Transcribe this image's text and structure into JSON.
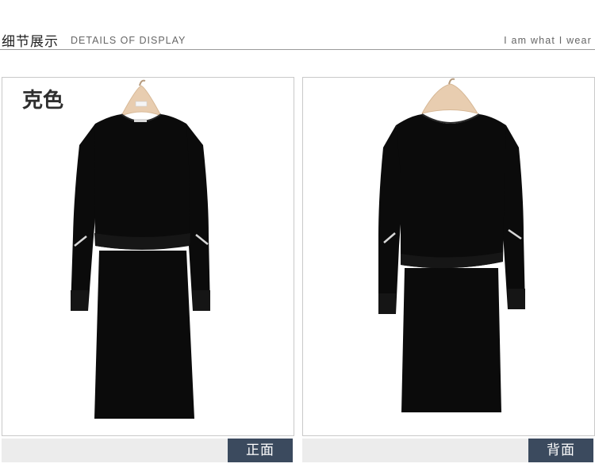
{
  "header": {
    "title_cn": "细节展示",
    "title_en": "DETAILS OF DISPLAY",
    "tagline": "I am what I wear"
  },
  "front": {
    "color_label": "克色",
    "view_label": "正面"
  },
  "back": {
    "view_label": "背面"
  },
  "colors": {
    "garment": "#0b0b0b",
    "tag_bg": "#3b4a5e",
    "strip_bg": "#ececec",
    "hanger": "#e8cdb0"
  }
}
